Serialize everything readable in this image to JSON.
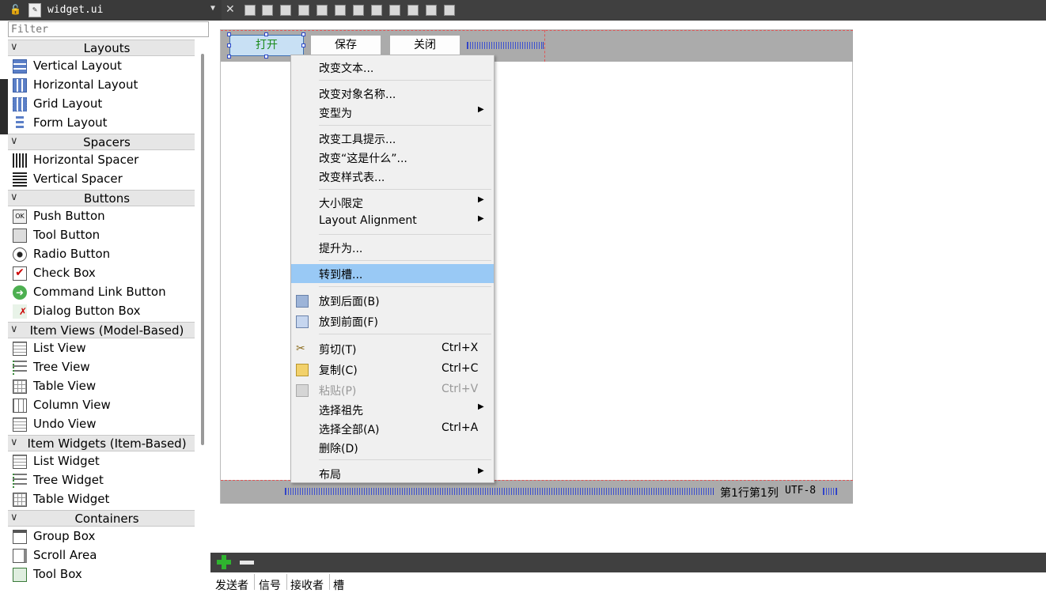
{
  "file_tab": {
    "filename": "widget.ui"
  },
  "widget_box": {
    "filter_placeholder": "Filter",
    "categories": [
      {
        "title": "Layouts",
        "items": [
          "Vertical Layout",
          "Horizontal Layout",
          "Grid Layout",
          "Form Layout"
        ]
      },
      {
        "title": "Spacers",
        "items": [
          "Horizontal Spacer",
          "Vertical Spacer"
        ]
      },
      {
        "title": "Buttons",
        "items": [
          "Push Button",
          "Tool Button",
          "Radio Button",
          "Check Box",
          "Command Link Button",
          "Dialog Button Box"
        ]
      },
      {
        "title": "Item Views (Model-Based)",
        "items": [
          "List View",
          "Tree View",
          "Table View",
          "Column View",
          "Undo View"
        ]
      },
      {
        "title": "Item Widgets (Item-Based)",
        "items": [
          "List Widget",
          "Tree Widget",
          "Table Widget"
        ]
      },
      {
        "title": "Containers",
        "items": [
          "Group Box",
          "Scroll Area",
          "Tool Box"
        ]
      }
    ]
  },
  "form": {
    "buttons": {
      "open": "打开",
      "save": "保存",
      "close": "关闭"
    },
    "status": {
      "position": "第1行第1列",
      "encoding": "UTF-8"
    }
  },
  "context_menu": {
    "change_text": "改变文本...",
    "change_object_name": "改变对象名称...",
    "morph_into": "变型为",
    "change_tooltip": "改变工具提示...",
    "change_whats_this": "改变“这是什么”...",
    "change_stylesheet": "改变样式表...",
    "size_constraints": "大小限定",
    "layout_alignment": "Layout Alignment",
    "promote_to": "提升为...",
    "go_to_slot": "转到槽...",
    "send_to_back": "放到后面(B)",
    "bring_to_front": "放到前面(F)",
    "cut": "剪切(T)",
    "cut_sc": "Ctrl+X",
    "copy": "复制(C)",
    "copy_sc": "Ctrl+C",
    "paste": "粘贴(P)",
    "paste_sc": "Ctrl+V",
    "select_ancestor": "选择祖先",
    "select_all": "选择全部(A)",
    "select_all_sc": "Ctrl+A",
    "delete": "删除(D)",
    "layout": "布局"
  },
  "signal_slot_editor": {
    "columns": [
      "发送者",
      "信号",
      "接收者",
      "槽"
    ]
  },
  "colors": {
    "highlight": "#99c9f5",
    "selected_button": "#c8e0f4",
    "dark_bar": "#404040"
  }
}
